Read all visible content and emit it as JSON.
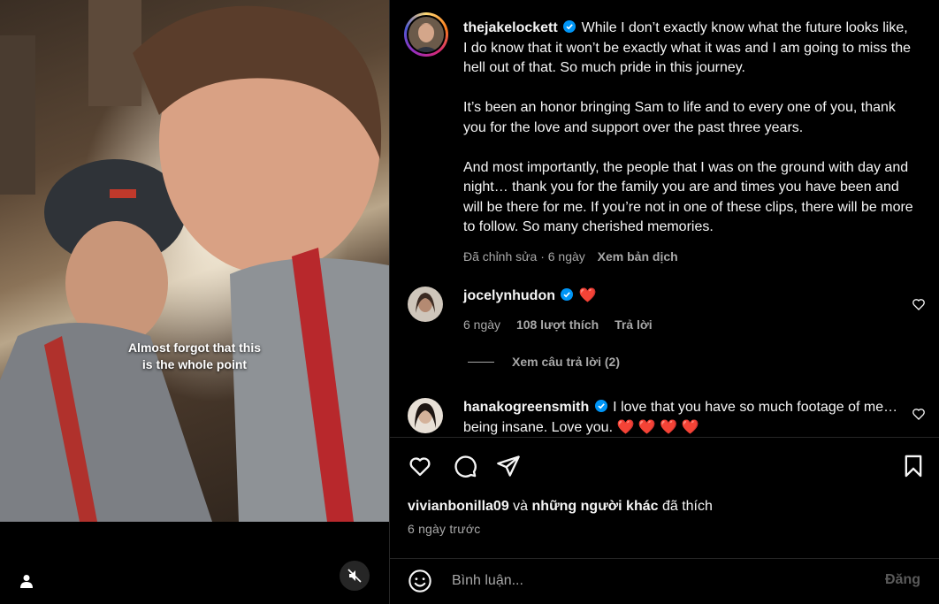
{
  "media": {
    "caption_line1": "Almost forgot that this",
    "caption_line2": "is the whole point",
    "mute_icon": "speaker-muted-icon",
    "tag_icon": "user-tag-icon"
  },
  "post": {
    "author": "thejakelockett",
    "verified_icon": "verified-badge-icon",
    "caption_paragraphs": [
      "While I don’t exactly know what the future looks like, I do know that it won’t be exactly what it was and I am going to miss the hell out of that. So much pride in this journey.",
      "It’s been an honor bringing Sam to life and to every one of you, thank you for the love and support over the past three years.",
      "And most importantly, the people that I was on the ground with day and night… thank you for the family you are and times you have been and will be there for me. If you’re not in one of these clips, there will be more to follow. So many cherished memories."
    ],
    "edited_label": "Đã chỉnh sửa · 6 ngày",
    "translate_label": "Xem bản dịch"
  },
  "comments": [
    {
      "username": "jocelynhudon",
      "text": "❤️",
      "age": "6 ngày",
      "likes": "108 lượt thích",
      "reply_label": "Trả lời",
      "view_replies": "Xem câu trả lời (2)"
    },
    {
      "username": "hanakogreensmith",
      "text": "I love that you have so much footage of me… being insane. Love you. ❤️ ❤️ ❤️ ❤️"
    }
  ],
  "footer": {
    "liked_by_user": "vivianbonilla09",
    "liked_by_connector": " và ",
    "liked_by_others": "những người khác",
    "liked_by_suffix": " đã thích",
    "timestamp": "6 ngày trước",
    "comment_placeholder": "Bình luận...",
    "post_label": "Đăng"
  },
  "colors": {
    "background": "#000000",
    "text": "#f5f5f5",
    "muted": "#a8a8a8",
    "verified": "#0095f6",
    "divider": "#262626"
  }
}
